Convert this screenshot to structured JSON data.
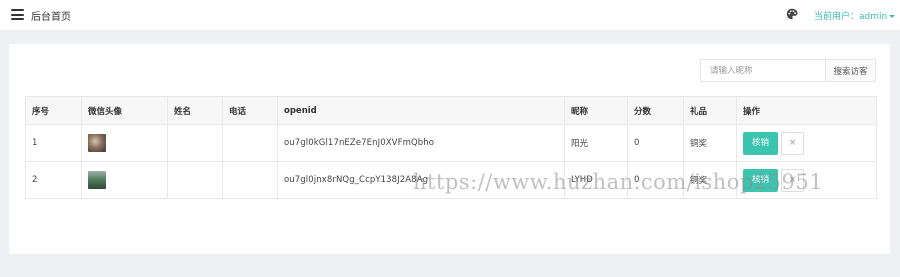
{
  "header": {
    "breadcrumb": "后台首页",
    "user_prefix": "当前用户：",
    "user_name": "admin"
  },
  "search": {
    "placeholder": "请输入昵称",
    "button_label": "搜索访客"
  },
  "table": {
    "columns": [
      "序号",
      "微信头像",
      "姓名",
      "电话",
      "openid",
      "昵称",
      "分数",
      "礼品",
      "操作"
    ],
    "rows": [
      {
        "index": "1",
        "name": "",
        "phone": "",
        "openid": "ou7gl0kGl17nEZe7EnJ0XVFmQbho",
        "nickname": "阳光",
        "score": "0",
        "gift": "铜奖"
      },
      {
        "index": "2",
        "name": "",
        "phone": "",
        "openid": "ou7gl0jnx8rNQg_CcpY138J2A8Ag",
        "nickname": "LYHD",
        "score": "0",
        "gift": "铜奖"
      }
    ],
    "verify_label": "核销",
    "delete_label": "×"
  },
  "watermark": "https://www.huzhan.com/ishop25951",
  "colors": {
    "accent": "#3bc5b0",
    "link": "#3bbfad",
    "background": "#eef0f3"
  }
}
